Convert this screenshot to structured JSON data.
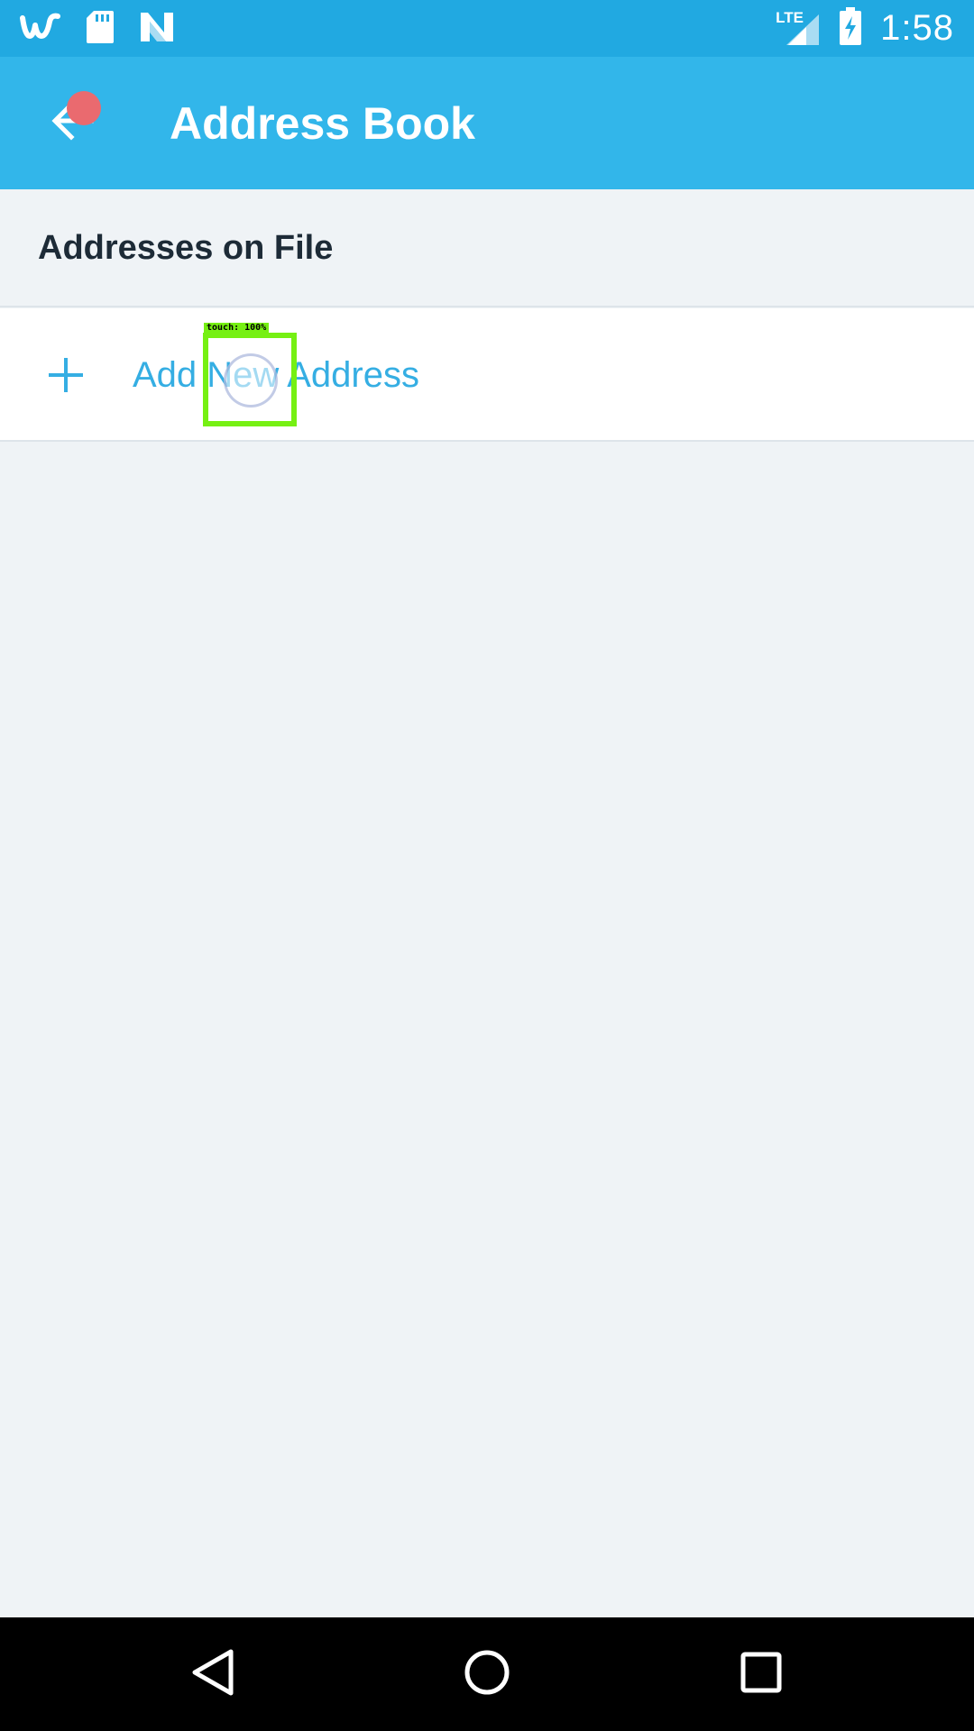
{
  "status_bar": {
    "time": "1:58",
    "network_label": "LTE",
    "left_icons": [
      "wish-app-icon",
      "sd-card-icon",
      "n-app-icon"
    ],
    "right_icons": [
      "lte-signal-icon",
      "battery-charging-icon"
    ]
  },
  "app_bar": {
    "title": "Address Book",
    "back_icon": "arrow-back-icon",
    "color": "#32b6ea"
  },
  "section": {
    "title": "Addresses on File"
  },
  "add_row": {
    "label": "Add New Address",
    "icon": "plus-icon",
    "color": "#35aee3"
  },
  "touch_overlay": {
    "label": "touch: 100%"
  },
  "nav_bar": {
    "buttons": [
      "back-triangle-icon",
      "home-circle-icon",
      "recents-square-icon"
    ]
  }
}
